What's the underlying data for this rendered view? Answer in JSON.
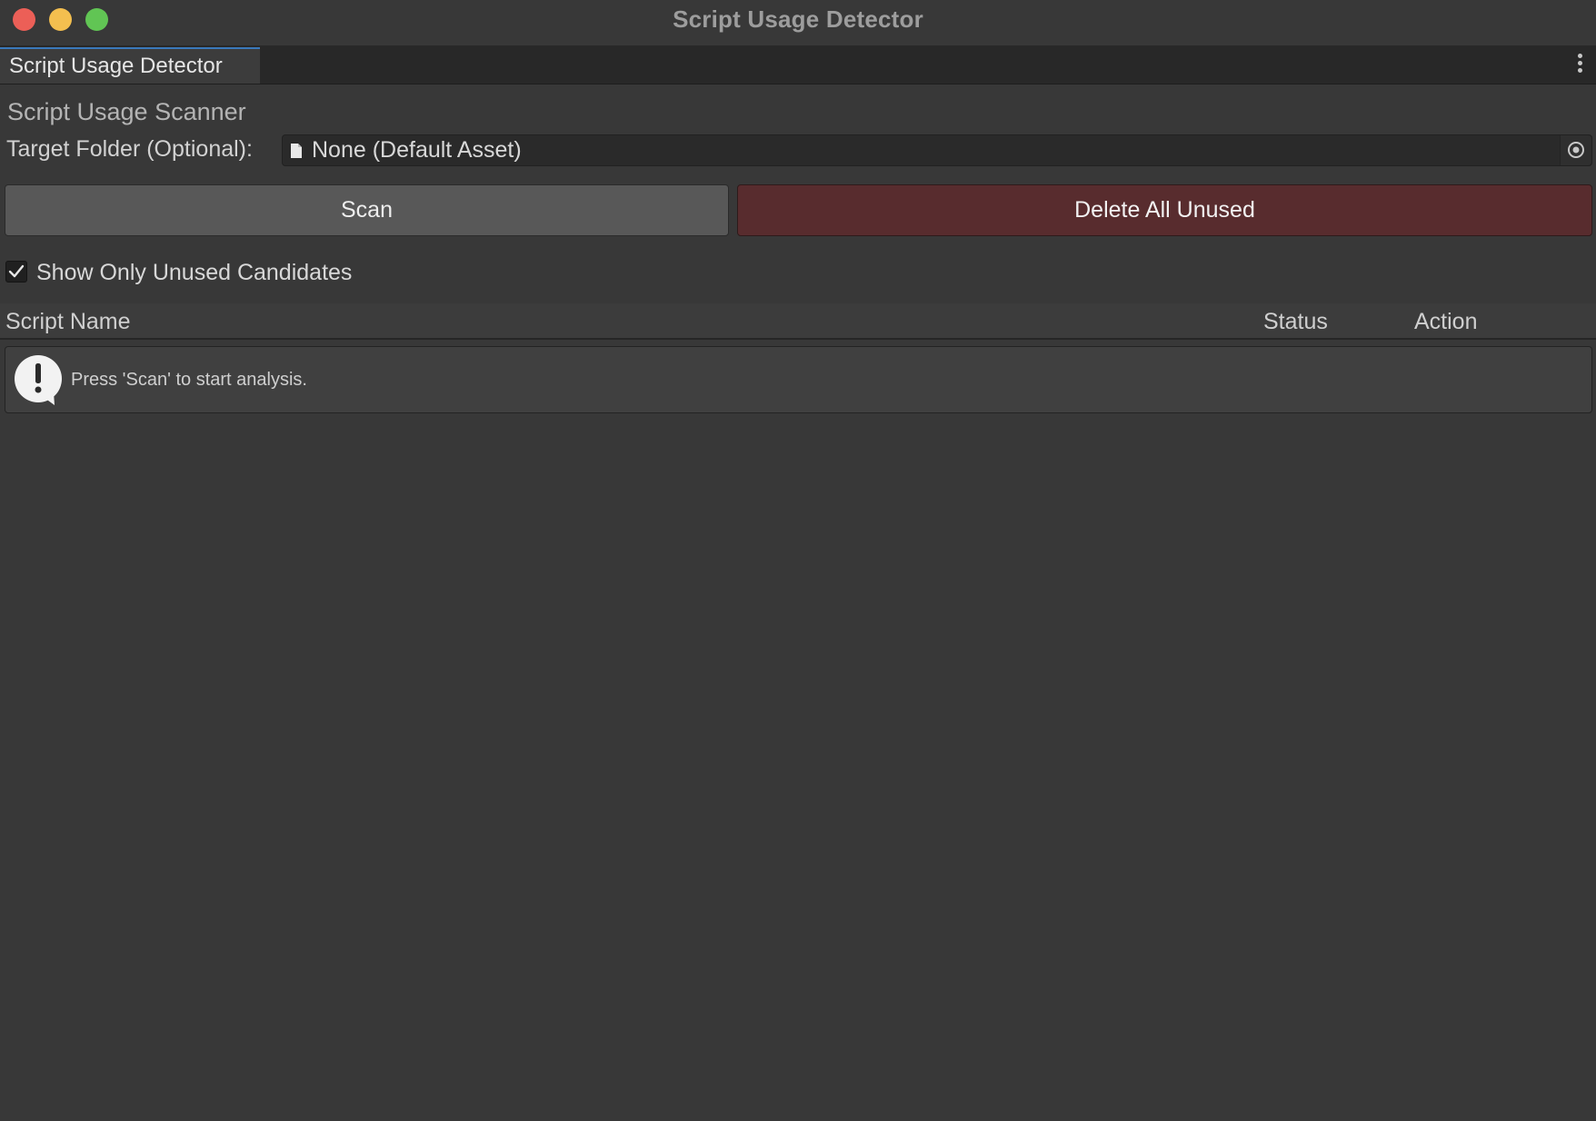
{
  "window": {
    "title": "Script Usage Detector"
  },
  "tab": {
    "label": "Script Usage Detector"
  },
  "scanner": {
    "section_title": "Script Usage Scanner",
    "target_folder_label": "Target Folder (Optional):",
    "target_folder_value": "None (Default Asset)",
    "scan_label": "Scan",
    "delete_label": "Delete All Unused",
    "show_unused_label": "Show Only Unused Candidates",
    "show_unused_checked": true
  },
  "table": {
    "columns": [
      "Script Name",
      "Status",
      "Action"
    ]
  },
  "help": {
    "message": "Press 'Scan' to start analysis."
  },
  "colors": {
    "background": "#383838",
    "delete_button": "#582c2e",
    "scan_button": "#585858",
    "tab_accent": "#3a79bb"
  },
  "icons": {
    "window_controls": [
      "close-button",
      "minimize-button",
      "maximize-button"
    ],
    "object_field": "file-icon",
    "picker": "object-picker-icon",
    "menu": "kebab-menu-icon",
    "help": "info-icon"
  }
}
